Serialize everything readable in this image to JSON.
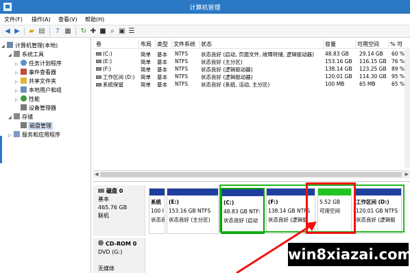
{
  "window": {
    "title": "计算机管理"
  },
  "menu": [
    "文件(F)",
    "操作(A)",
    "查看(V)",
    "帮助(H)"
  ],
  "toolbar": {
    "icons": [
      "back-icon",
      "forward-icon",
      "folder-up-icon",
      "properties-icon",
      "help-icon",
      "view-icon",
      "refresh-icon",
      "new-icon",
      "delete-icon",
      "search-icon",
      "settings-icon"
    ]
  },
  "tree": {
    "root": "计算机管理(本地)",
    "system_tools": "系统工具",
    "task_scheduler": "任务计划程序",
    "event_viewer": "事件查看器",
    "shared_folders": "共享文件夹",
    "local_users": "本地用户和组",
    "performance": "性能",
    "device_manager": "设备管理器",
    "storage": "存储",
    "disk_management": "磁盘管理",
    "services": "服务和应用程序"
  },
  "table": {
    "headers": [
      "卷",
      "布局",
      "类型",
      "文件系统",
      "状态",
      "容量",
      "可用空间",
      "% 可"
    ],
    "rows": [
      [
        "(C:)",
        "简单",
        "基本",
        "NTFS",
        "状态良好 (启动, 页面文件, 故障转储, 逻辑驱动器)",
        "48.83 GB",
        "29.14 GB",
        "60 %"
      ],
      [
        "(E:)",
        "简单",
        "基本",
        "NTFS",
        "状态良好 (主分区)",
        "153.16 GB",
        "116.15 GB",
        "76 %"
      ],
      [
        "(F:)",
        "简单",
        "基本",
        "NTFS",
        "状态良好 (逻辑驱动器)",
        "138.14 GB",
        "123.25 GB",
        "89 %"
      ],
      [
        "工作区间 (D:)",
        "简单",
        "基本",
        "NTFS",
        "状态良好 (逻辑驱动器)",
        "120.01 GB",
        "114.30 GB",
        "95 %"
      ],
      [
        "系统保留",
        "简单",
        "基本",
        "NTFS",
        "状态良好 (系统, 活动, 主分区)",
        "100 MB",
        "65 MB",
        "65 %"
      ]
    ]
  },
  "disk0": {
    "name": "磁盘 0",
    "type": "基本",
    "size": "465.76 GB",
    "status": "联机",
    "partitions": [
      {
        "name": "系统",
        "line1": "100 I",
        "line2": "状态良"
      },
      {
        "name": "(E:)",
        "line1": "153.16 GB NTFS",
        "line2": "状态良好 (主分区)"
      },
      {
        "name": "(C:)",
        "line1": "48.83 GB NTF:",
        "line2": "状态良好 (启动"
      },
      {
        "name": "(F:)",
        "line1": "138.14 GB NTFS",
        "line2": "状态良好 (逻辑驱"
      },
      {
        "name": "",
        "line1": "5.52 GB",
        "line2": "可用空间"
      },
      {
        "name": "工作区间 (D:)",
        "line1": "120.01 GB NTFS",
        "line2": "状态良好 (逻辑驱"
      }
    ]
  },
  "cdrom": {
    "name": "CD-ROM 0",
    "drive": "DVD (G:)",
    "media": "无媒体"
  },
  "colors": {
    "primary_bar": "#1f3f9e",
    "free_space_bar": "#21c521",
    "highlight_box": "#f01010",
    "titlebar": "#2b78c5"
  },
  "watermark": "win8xiazai.com"
}
